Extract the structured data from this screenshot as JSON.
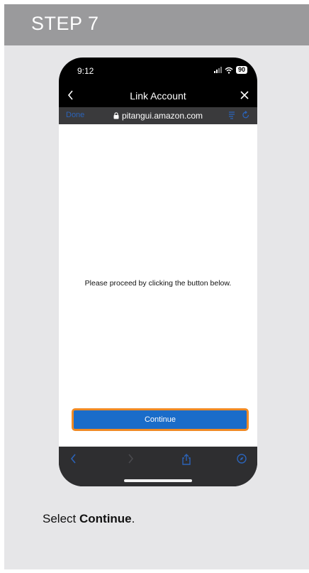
{
  "step": {
    "title": "STEP 7"
  },
  "phone": {
    "status_time": "9:12",
    "battery_level": "90",
    "nav_title": "Link Account",
    "browser": {
      "done_label": "Done",
      "url": "pitangui.amazon.com"
    },
    "content": {
      "message": "Please proceed by clicking the button below.",
      "continue_label": "Continue"
    }
  },
  "instruction": {
    "prefix": "Select ",
    "emphasis": "Continue",
    "suffix": "."
  },
  "colors": {
    "header": "#9a9a9c",
    "card": "#e6e6e8",
    "button": "#1a6cc9",
    "highlight": "#f08a24"
  }
}
